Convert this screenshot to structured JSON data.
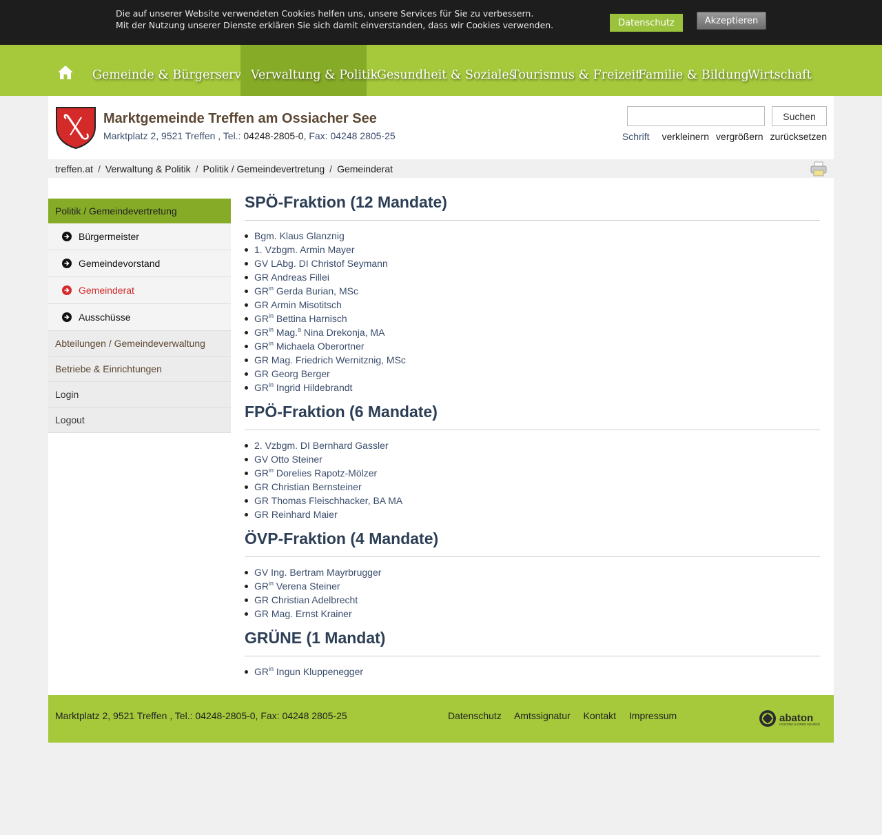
{
  "cookie": {
    "line1": "Die auf unserer Website verwendeten Cookies helfen uns, unsere Services für Sie zu verbessern.",
    "line2": "Mit der Nutzung unserer Dienste erklären Sie sich damit einverstanden, dass wir Cookies verwenden.",
    "privacy_label": "Datenschutz",
    "accept_label": "Akzeptieren"
  },
  "nav": {
    "home_icon": "home-icon",
    "items": [
      {
        "label": "Gemeinde & Bürgerservice"
      },
      {
        "label": "Verwaltung & Politik"
      },
      {
        "label": "Gesundheit & Soziales"
      },
      {
        "label": "Tourismus & Freizeit"
      },
      {
        "label": "Familie & Bildung"
      },
      {
        "label": "Wirtschaft"
      }
    ]
  },
  "header": {
    "title": "Marktgemeinde Treffen am Ossiacher See",
    "address": "Marktplatz 2, 9521 Treffen , Tel.: ",
    "tel": "04248-2805-0",
    "fax": ", Fax: 04248 2805-25",
    "search_label": "Suchen",
    "font_label": "Schrift",
    "font_smaller": "verkleinern",
    "font_larger": "vergrößern",
    "font_reset": "zurücksetzen"
  },
  "breadcrumb": [
    "treffen.at",
    "Verwaltung & Politik",
    "Politik / Gemeindevertretung",
    "Gemeinderat"
  ],
  "sidebar": {
    "top": "Politik / Gemeindevertretung",
    "subitems": [
      {
        "label": "Bürgermeister"
      },
      {
        "label": "Gemeindevorstand"
      },
      {
        "label": "Gemeinderat"
      },
      {
        "label": "Ausschüsse"
      }
    ],
    "items": [
      {
        "label": "Abteilungen / Gemeindeverwaltung"
      },
      {
        "label": "Betriebe & Einrichtungen"
      },
      {
        "label": "Login"
      },
      {
        "label": "Logout"
      }
    ]
  },
  "sections": [
    {
      "title": "SPÖ-Fraktion (12 Mandate)",
      "members": [
        {
          "pre": "Bgm. Klaus Glanznig"
        },
        {
          "pre": "1. Vzbgm. Armin Mayer"
        },
        {
          "pre": "GV LAbg. DI Christof Seymann"
        },
        {
          "pre": "GR Andreas Fillei"
        },
        {
          "pre": "GR",
          "sup": "in",
          "post": " Gerda Burian, MSc"
        },
        {
          "pre": "GR Armin Misotitsch"
        },
        {
          "pre": "GR",
          "sup": "in",
          "post": " Bettina Harnisch"
        },
        {
          "pre": "GR",
          "sup": "in",
          "post": " Mag.",
          "sup2": "a",
          "post2": " Nina Drekonja, MA"
        },
        {
          "pre": "GR",
          "sup": "in",
          "post": " Michaela Oberortner"
        },
        {
          "pre": "GR Mag. Friedrich Wernitznig, MSc"
        },
        {
          "pre": "GR Georg Berger"
        },
        {
          "pre": "GR",
          "sup": "in",
          "post": " Ingrid Hildebrandt"
        }
      ]
    },
    {
      "title": "FPÖ-Fraktion (6 Mandate)",
      "members": [
        {
          "pre": "2. Vzbgm. DI Bernhard Gassler"
        },
        {
          "pre": "GV Otto Steiner"
        },
        {
          "pre": "GR",
          "sup": "in",
          "post": " Dorelies Rapotz-Mölzer"
        },
        {
          "pre": "GR Christian Bernsteiner"
        },
        {
          "pre": "GR Thomas Fleischhacker, BA MA"
        },
        {
          "pre": "GR Reinhard Maier"
        }
      ]
    },
    {
      "title": "ÖVP-Fraktion (4 Mandate)",
      "members": [
        {
          "pre": "GV Ing. Bertram Mayrbrugger"
        },
        {
          "pre": "GR",
          "sup": "in",
          "post": " Verena Steiner"
        },
        {
          "pre": "GR Christian Adelbrecht"
        },
        {
          "pre": "GR Mag. Ernst Krainer"
        }
      ]
    },
    {
      "title": "GRÜNE (1 Mandat)",
      "members": [
        {
          "pre": "GR",
          "sup": "in",
          "post": " Ingun Kluppenegger"
        }
      ]
    }
  ],
  "footer": {
    "address": "Marktplatz 2, 9521 Treffen , Tel.: 04248-2805-0, Fax: 04248 2805-25",
    "links": [
      {
        "label": "Datenschutz"
      },
      {
        "label": "Amtssignatur"
      },
      {
        "label": "Kontakt"
      },
      {
        "label": "Impressum"
      }
    ],
    "logo_text": "abaton",
    "logo_tagline": "HOSTING & OPEN SOURCE"
  },
  "colors": {
    "nav_green": "#a5c93b",
    "nav_active": "#86ab27",
    "heading_blue": "#2c3e55",
    "active_red": "#d42a2a"
  }
}
